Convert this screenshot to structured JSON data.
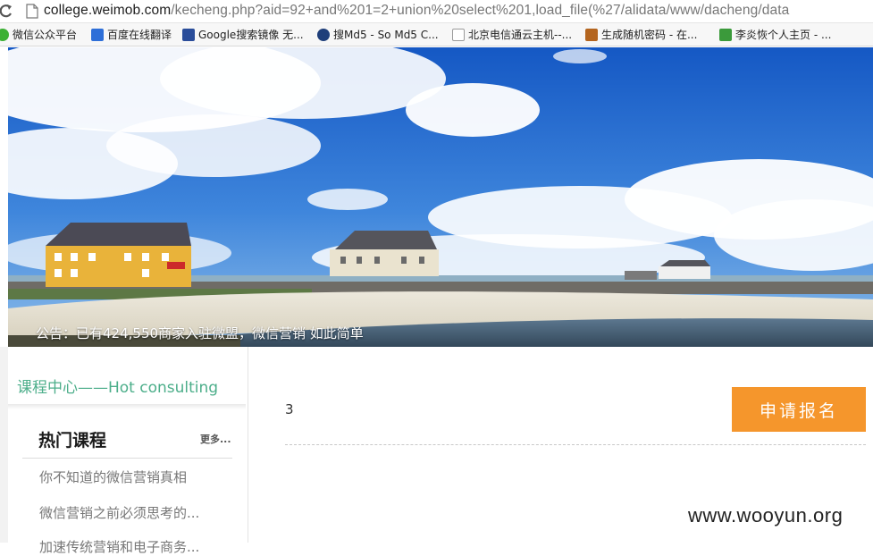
{
  "browser": {
    "url_host": "college.weimob.com",
    "url_path": "/kecheng.php?aid=92+and%201=2+union%20select%201,load_file(%27/alidata/www/dacheng/data"
  },
  "bookmarks": [
    {
      "label": "微信公众平台",
      "icon": "wechat-icon",
      "color": "#3cb034"
    },
    {
      "label": "百度在线翻译",
      "icon": "baidu-translate-icon",
      "color": "#2e6fd8"
    },
    {
      "label": "Google搜索镜像 无...",
      "icon": "google-mirror-icon",
      "color": "#2a4d9a"
    },
    {
      "label": "搜Md5 - So Md5 C...",
      "icon": "somd5-icon",
      "color": "#1f3f7a"
    },
    {
      "label": "北京电信通云主机--...",
      "icon": "page-icon",
      "color": "#9a9a9a"
    },
    {
      "label": "生成随机密码 - 在...",
      "icon": "tools-icon",
      "color": "#b4651f"
    },
    {
      "label": "李炎恢个人主页 - ...",
      "icon": "bookmark-icon",
      "color": "#3b9a3b"
    }
  ],
  "hero": {
    "notice": "公告：已有424,550商家入驻微盟，微信营销 如此简单"
  },
  "sidebar": {
    "category_title": "课程中心——Hot consulting",
    "hot_title": "热门课程",
    "more": "更多...",
    "courses": [
      "你不知道的微信营销真相",
      "微信营销之前必须思考的...",
      "加速传统营销和电子商务..."
    ]
  },
  "main": {
    "count": "3",
    "apply_label": "申请报名",
    "watermark": "www.wooyun.org"
  },
  "colors": {
    "accent_green": "#4cae8a",
    "apply_orange": "#f5962c",
    "sky_blue": "#1f6fd1"
  }
}
